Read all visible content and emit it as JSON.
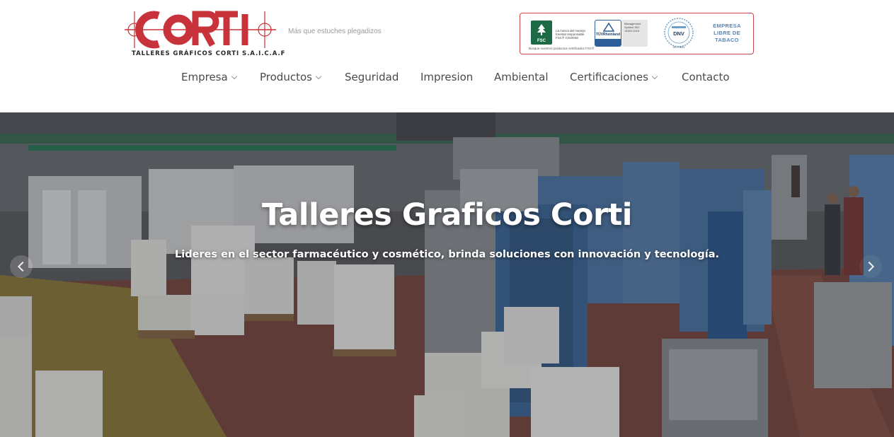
{
  "brand": {
    "logo_text": "CORTI",
    "logo_caption": "TALLERES GRÁFICOS CORTI S.A.I.C.A.F",
    "tagline": "Más que estuches plegadizos",
    "accent_color": "#c8323a"
  },
  "certifications": {
    "fsc_label": "FSC",
    "fsc_text": "La marca del manejo forestal responsable",
    "fsc_code": "FSC® C010048",
    "fsc_sub": "Busque nuestros productos certificados FSC®",
    "tuv_label": "TÜVRheinland",
    "tuv_card_text": "Management System ISO 14001:2015",
    "dnv_label": "DNV",
    "dnv_foot": "ISO 9001",
    "tabaco_line1": "EMPRESA",
    "tabaco_line2": "LIBRE DE",
    "tabaco_line3": "TABACO"
  },
  "nav": {
    "items": [
      {
        "label": "Empresa",
        "dropdown": true
      },
      {
        "label": "Productos",
        "dropdown": true
      },
      {
        "label": "Seguridad",
        "dropdown": false
      },
      {
        "label": "Impresion",
        "dropdown": false
      },
      {
        "label": "Ambiental",
        "dropdown": false
      },
      {
        "label": "Certificaciones",
        "dropdown": true
      },
      {
        "label": "Contacto",
        "dropdown": false
      }
    ]
  },
  "hero": {
    "title": "Talleres Graficos Corti",
    "subtitle": "Lideres en el sector farmacéutico y cosmético, brinda soluciones con innovación y tecnología.",
    "prev_icon": "chevron-left-icon",
    "next_icon": "chevron-right-icon"
  }
}
